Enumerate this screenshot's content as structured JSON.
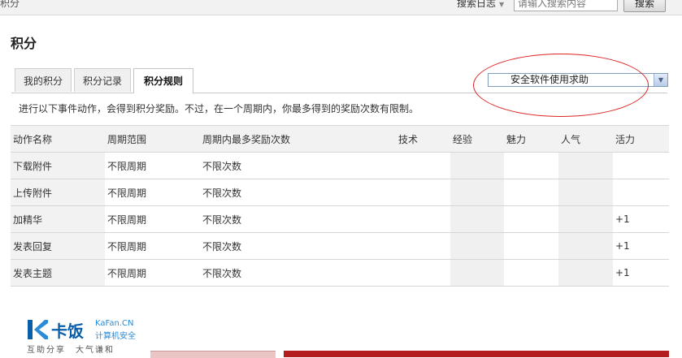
{
  "topbar": {
    "crumb": "积分",
    "search_log": "搜索日志",
    "search_placeholder": "请输入搜索内容",
    "search_button": "搜索"
  },
  "page_title": "积分",
  "tabs": [
    {
      "label": "我的积分"
    },
    {
      "label": "积分记录"
    },
    {
      "label": "积分规则",
      "active": true
    }
  ],
  "help_select": {
    "value": "安全软件使用求助"
  },
  "notice": "进行以下事件动作，会得到积分奖励。不过，在一个周期内，你最多得到的奖励次数有限制。",
  "table": {
    "headers": [
      "动作名称",
      "周期范围",
      "周期内最多奖励次数",
      "技术",
      "经验",
      "魅力",
      "人气",
      "活力"
    ],
    "rows": [
      [
        "下载附件",
        "不限周期",
        "不限次数",
        "",
        "",
        "",
        "",
        ""
      ],
      [
        "上传附件",
        "不限周期",
        "不限次数",
        "",
        "",
        "",
        "",
        ""
      ],
      [
        "加精华",
        "不限周期",
        "不限次数",
        "",
        "",
        "",
        "",
        "+1"
      ],
      [
        "发表回复",
        "不限周期",
        "不限次数",
        "",
        "",
        "",
        "",
        "+1"
      ],
      [
        "发表主题",
        "不限周期",
        "不限次数",
        "",
        "",
        "",
        "",
        "+1"
      ]
    ]
  },
  "footer": {
    "logo_cn": "卡饭",
    "logo_en": "KaFan.CN",
    "logo_sub": "计算机安全",
    "slogan": "互助分享　大气谦和"
  },
  "colors": {
    "annotation_ellipse": "#d22222",
    "logo_blue": "#0b5fa9"
  }
}
